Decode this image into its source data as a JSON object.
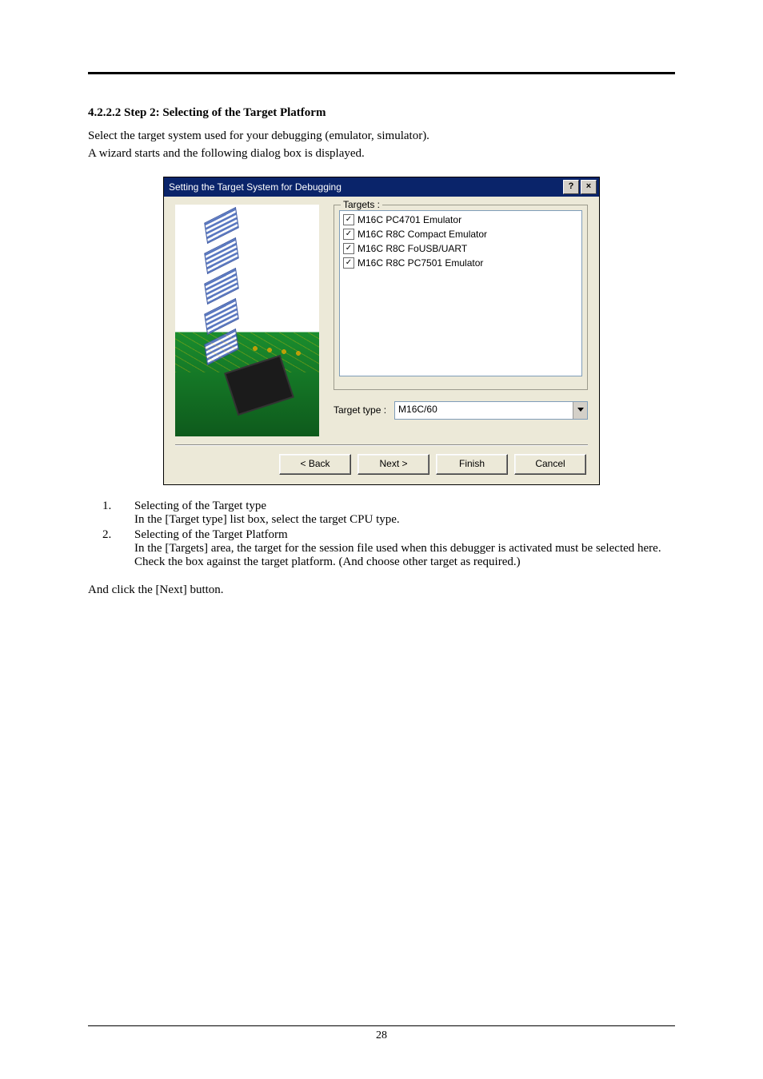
{
  "heading": "4.2.2.2 Step 2: Selecting of the Target Platform",
  "intro_line1": "Select the target system used for your debugging (emulator, simulator).",
  "intro_line2": "A wizard starts and the following dialog box is displayed.",
  "dialog": {
    "title": "Setting the Target System for Debugging",
    "help_glyph": "?",
    "close_glyph": "×",
    "targets_legend": "Targets :",
    "items": [
      "M16C PC4701 Emulator",
      "M16C R8C Compact Emulator",
      "M16C R8C FoUSB/UART",
      "M16C R8C PC7501 Emulator"
    ],
    "check_glyph": "✓",
    "target_type_label": "Target type :",
    "target_type_value": "M16C/60",
    "buttons": {
      "back": "< Back",
      "next": "Next >",
      "finish": "Finish",
      "cancel": "Cancel"
    }
  },
  "list": {
    "n1": "1.",
    "t1": "Selecting of the Target type",
    "b1": "In the [Target type] list box, select the target CPU type.",
    "n2": "2.",
    "t2": "Selecting of the Target Platform",
    "b2a": "In the [Targets] area, the target for the session file used when this debugger is activated must be selected here.",
    "b2b": "Check the box against the target platform. (And choose other target as required.)"
  },
  "closing": "And click the [Next] button.",
  "page_number": "28"
}
